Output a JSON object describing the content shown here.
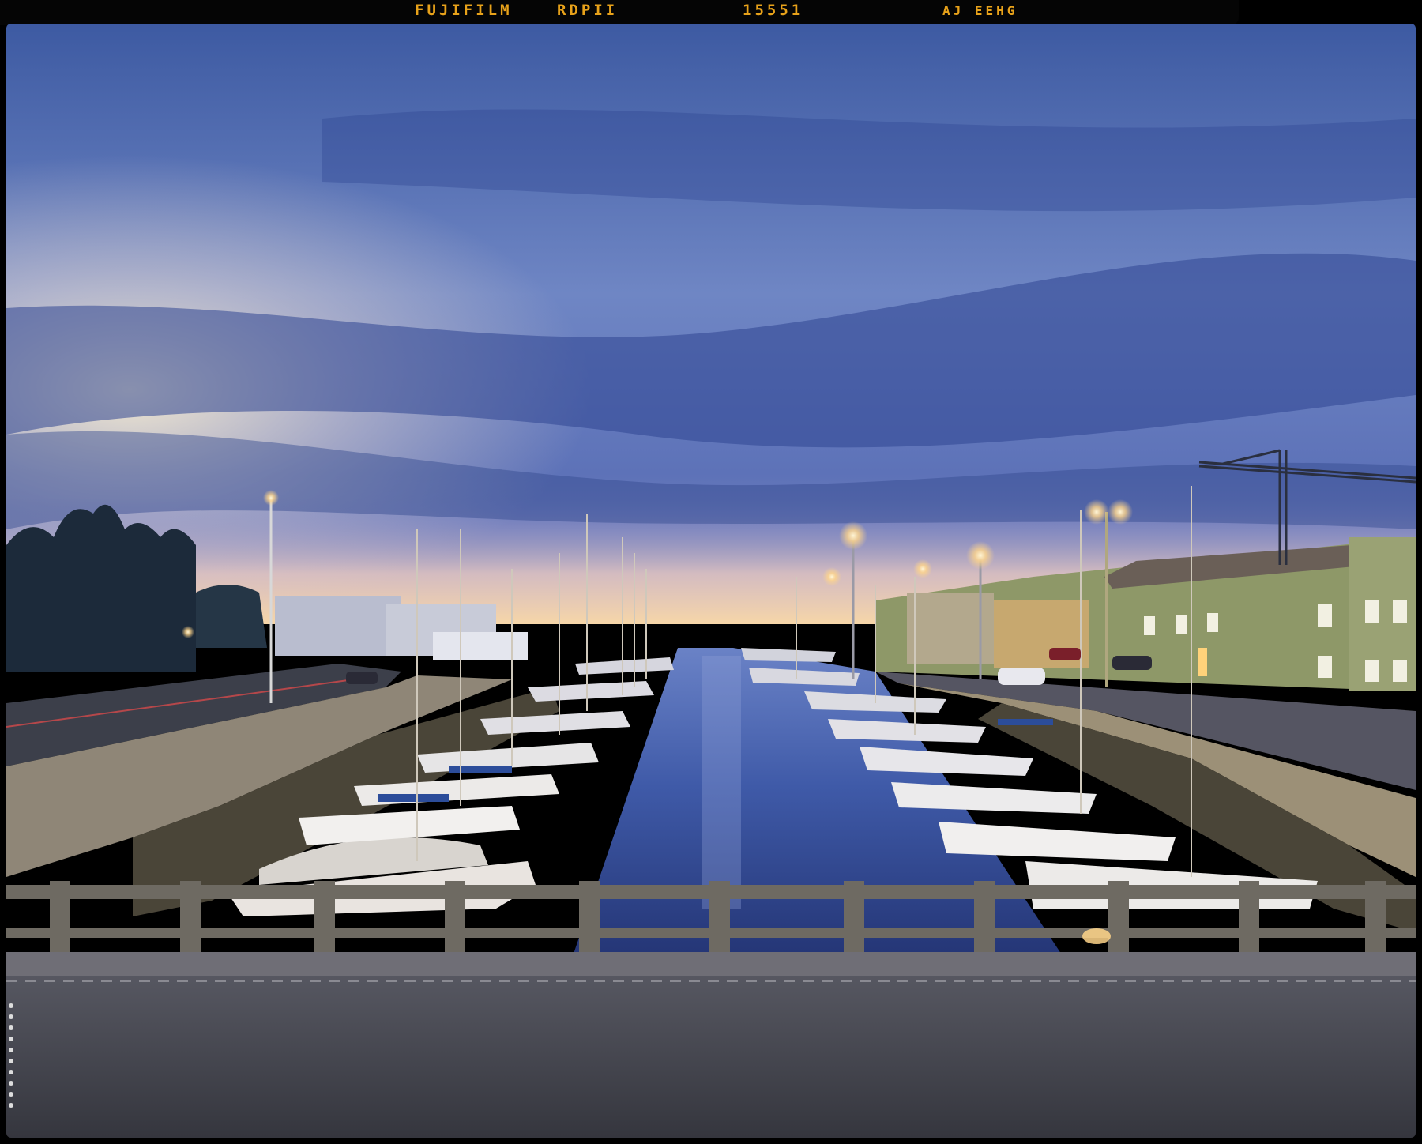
{
  "film_edge": {
    "brand": "FUJIFILM",
    "stock": "RDPII",
    "frame_number": "15551",
    "code": "AJ EEHG"
  },
  "scene": {
    "colors": {
      "sky_top": "#3f5a9e",
      "sky_mid": "#6f86c2",
      "sky_glow": "#f3e6c8",
      "water": "#3b57a6",
      "road": "#4b4c55",
      "street_light": "#ffd58a",
      "building_green": "#8e9868",
      "film_text": "#e8a21a"
    }
  }
}
